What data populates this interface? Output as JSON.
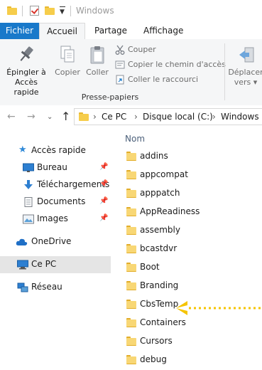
{
  "window": {
    "title": "Windows"
  },
  "ribbon_tabs": {
    "file": "Fichier",
    "home": "Accueil",
    "share": "Partage",
    "view": "Affichage"
  },
  "ribbon": {
    "pin_quick_access": [
      "Épingler à",
      "Accès rapide"
    ],
    "copy": "Copier",
    "paste": "Coller",
    "cut": "Couper",
    "copy_path": "Copier le chemin d'accès",
    "paste_shortcut": "Coller le raccourci",
    "move_to": [
      "Déplacer",
      "vers"
    ],
    "group_clipboard": "Presse-papiers"
  },
  "address": {
    "segments": [
      "Ce PC",
      "Disque local (C:)",
      "Windows"
    ]
  },
  "nav_pane": {
    "quick_access": "Accès rapide",
    "items": [
      {
        "label": "Bureau",
        "icon": "desktop-icon",
        "pinned": true
      },
      {
        "label": "Téléchargements",
        "icon": "download-icon",
        "pinned": true
      },
      {
        "label": "Documents",
        "icon": "documents-icon",
        "pinned": true
      },
      {
        "label": "Images",
        "icon": "pictures-icon",
        "pinned": true
      }
    ],
    "onedrive": "OneDrive",
    "this_pc": "Ce PC",
    "network": "Réseau"
  },
  "file_list": {
    "column_name": "Nom",
    "folders": [
      "addins",
      "appcompat",
      "apppatch",
      "AppReadiness",
      "assembly",
      "bcastdvr",
      "Boot",
      "Branding",
      "CbsTemp",
      "Containers",
      "Cursors",
      "debug"
    ]
  },
  "colors": {
    "accent": "#1979ca",
    "folder": "#f8d775",
    "annotation_arrow": "#f5c400",
    "selection": "#cde0f2"
  }
}
